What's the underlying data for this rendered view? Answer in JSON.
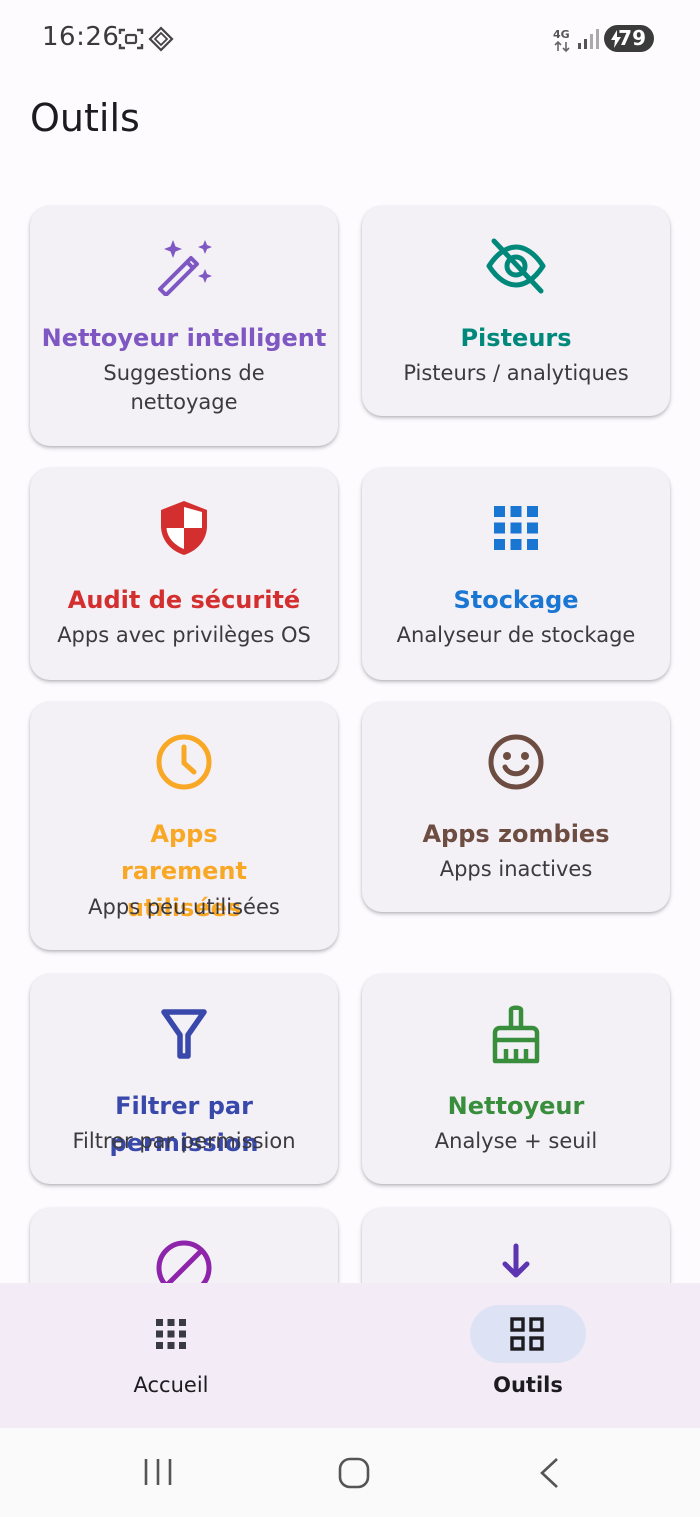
{
  "status_bar": {
    "time": "16:26",
    "network": "4G",
    "battery": "79"
  },
  "page": {
    "title": "Outils"
  },
  "tools": [
    {
      "title": "Nettoyeur intelligent",
      "subtitle": "Suggestions de nettoyage",
      "color": "#7e57c2",
      "icon": "magic-wand-icon"
    },
    {
      "title": "Pisteurs",
      "subtitle": "Pisteurs / analytiques",
      "color": "#00897b",
      "icon": "eye-off-icon"
    },
    {
      "title": "Audit de sécurité",
      "subtitle": "Apps avec privilèges OS",
      "color": "#d32f2f",
      "icon": "shield-icon"
    },
    {
      "title": "Stockage",
      "subtitle": "Analyseur de stockage",
      "color": "#1976d2",
      "icon": "storage-grid-icon"
    },
    {
      "title": "Apps rarement utilisées",
      "subtitle": "Apps peu utilisées",
      "color": "#f9a825",
      "icon": "clock-icon"
    },
    {
      "title": "Apps zombies",
      "subtitle": "Apps inactives",
      "color": "#6d4c41",
      "icon": "smiley-icon"
    },
    {
      "title": "Filtrer par permission",
      "subtitle": "Filtrer par permission",
      "color": "#3949ab",
      "icon": "filter-icon"
    },
    {
      "title": "Nettoyeur",
      "subtitle": "Analyse + seuil",
      "color": "#388e3c",
      "icon": "broom-icon"
    },
    {
      "title": "",
      "subtitle": "",
      "color": "#8e24aa",
      "icon": "block-icon"
    },
    {
      "title": "",
      "subtitle": "",
      "color": "#5e35b1",
      "icon": "download-icon"
    }
  ],
  "bottom_nav": {
    "items": [
      {
        "label": "Accueil",
        "icon": "apps-grid-icon",
        "selected": false
      },
      {
        "label": "Outils",
        "icon": "dashboard-icon",
        "selected": true
      }
    ],
    "selected_pill_color": "#dde3f5"
  },
  "system_nav": {
    "icons": [
      "recents-icon",
      "home-icon",
      "back-icon"
    ]
  }
}
